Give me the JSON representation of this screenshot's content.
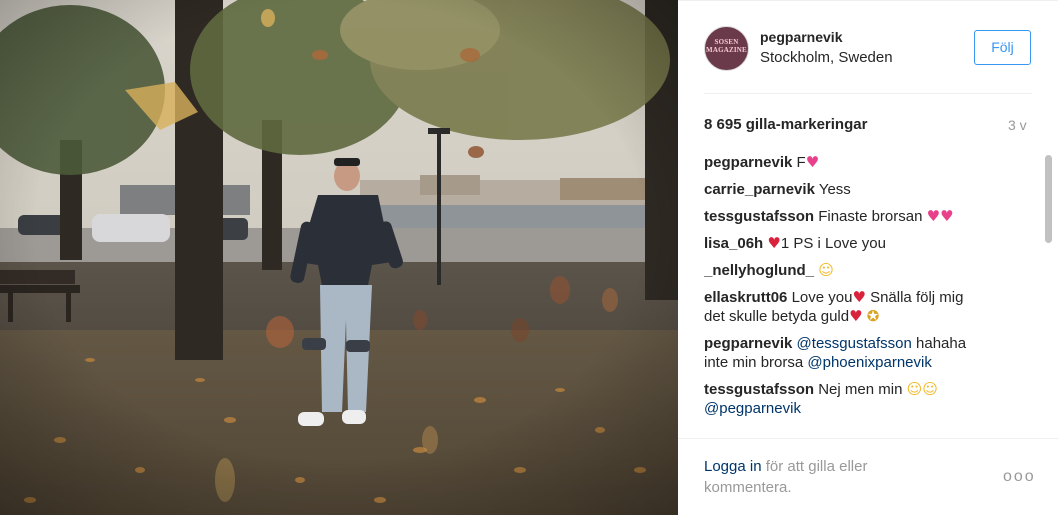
{
  "post": {
    "username": "pegparnevik",
    "location": "Stockholm, Sweden",
    "follow_label": "Följ",
    "likes": "8 695 gilla-markeringar",
    "time_ago": "3 v",
    "avatar_text": "SOSEN MAGAZINE"
  },
  "comments": [
    {
      "user": "carrie_parnevik",
      "text": "Yess"
    },
    {
      "user": "tessgustafsson",
      "text": "Finaste brorsan"
    },
    {
      "user": "lisa_06h",
      "text": "1 PS i Love you"
    },
    {
      "user": "_nellyhoglund_"
    },
    {
      "user": "ellaskrutt06",
      "text_a": "Love you",
      "text_b": "Snälla följ mig",
      "text_c": "det skulle betyda guld"
    },
    {
      "user": "pegparnevik",
      "mention_a": "@tessgustafsson",
      "text": "hahaha",
      "text_b": "inte min brorsa",
      "mention_b": "@phoenixparnevik"
    },
    {
      "user": "tessgustafsson",
      "text": "Nej men min",
      "mention": "@pegparnevik"
    }
  ],
  "caption": {
    "user": "pegparnevik",
    "text": "F"
  },
  "footer": {
    "login_label": "Logga in",
    "rest_text": "för att gilla eller",
    "rest_text_2": "kommentera.",
    "more_label": "ooo"
  },
  "icons": {
    "heart": "heart-icon",
    "pink_heart": "sparkling-heart-icon",
    "smile": "heart-eyes-face-icon",
    "kiss": "kissing-face-icon",
    "medal": "medal-icon"
  },
  "colors": {
    "accent": "#3897f0",
    "link": "#003569",
    "muted": "#999999"
  }
}
